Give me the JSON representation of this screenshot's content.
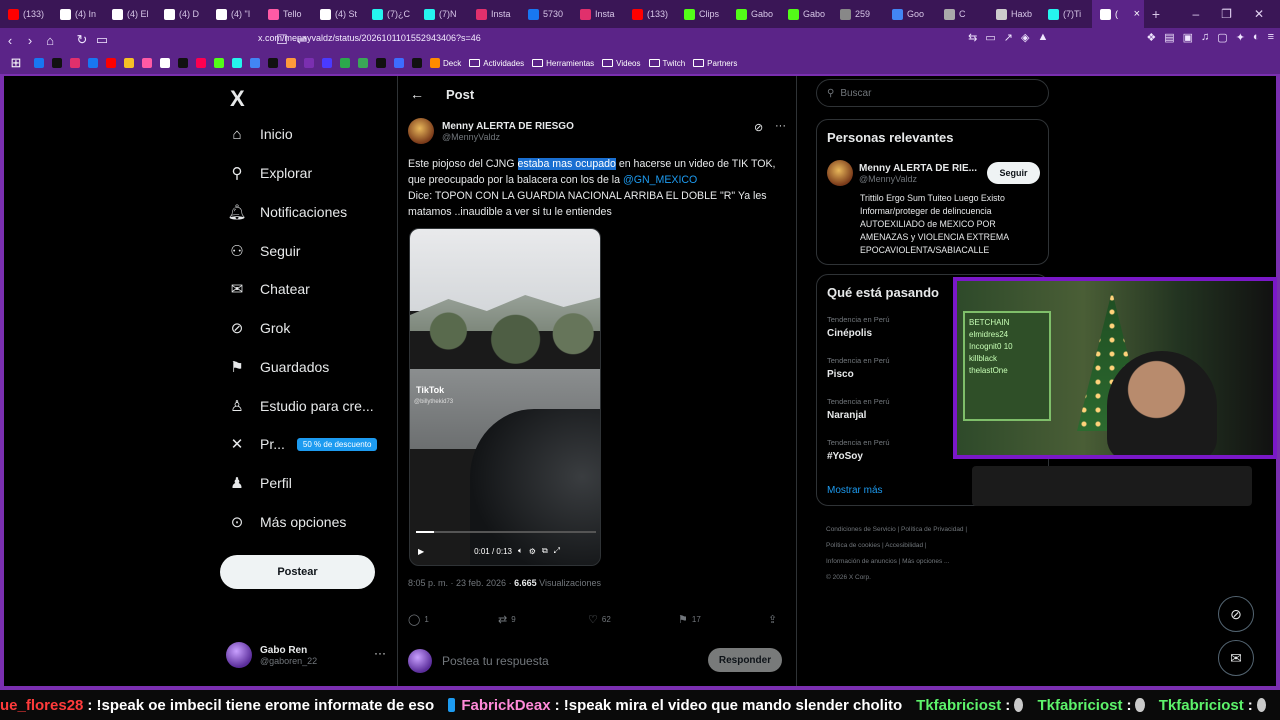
{
  "browser": {
    "tabs": [
      {
        "label": "(133)",
        "color": "#ff0000"
      },
      {
        "label": "(4) In",
        "color": "#ffffff"
      },
      {
        "label": "(4) El",
        "color": "#ffffff"
      },
      {
        "label": "(4) D",
        "color": "#ffffff"
      },
      {
        "label": "(4) \"I",
        "color": "#ffffff"
      },
      {
        "label": "Tello",
        "color": "#ff5aa5"
      },
      {
        "label": "(4) St",
        "color": "#ffffff"
      },
      {
        "label": "(7)¿C",
        "color": "#25f4ee"
      },
      {
        "label": "(7)N",
        "color": "#25f4ee"
      },
      {
        "label": "Insta",
        "color": "#e1306c"
      },
      {
        "label": "5730",
        "color": "#1877f2"
      },
      {
        "label": "Insta",
        "color": "#e1306c"
      },
      {
        "label": "(133)",
        "color": "#ff0000"
      },
      {
        "label": "Clips",
        "color": "#53fc18"
      },
      {
        "label": "Gabo",
        "color": "#53fc18"
      },
      {
        "label": "Gabo",
        "color": "#53fc18"
      },
      {
        "label": "259",
        "color": "#888888"
      },
      {
        "label": "Goo",
        "color": "#4285f4"
      },
      {
        "label": "C",
        "color": "#aaaaaa"
      },
      {
        "label": "Haxb",
        "color": "#cccccc"
      },
      {
        "label": "(7)Ti",
        "color": "#25f4ee"
      },
      {
        "label": "(",
        "color": "#ffffff"
      }
    ],
    "url": "x.com/mennyvaldz/status/2026101101552943406?s=46",
    "bookmarks": [
      "Deck",
      "Actividades",
      "Herramientas",
      "Videos",
      "Twitch",
      "Partners"
    ]
  },
  "nav": {
    "logo": "X",
    "items": [
      {
        "label": "Inicio"
      },
      {
        "label": "Explorar"
      },
      {
        "label": "Notificaciones"
      },
      {
        "label": "Seguir"
      },
      {
        "label": "Chatear"
      },
      {
        "label": "Grok"
      },
      {
        "label": "Guardados"
      },
      {
        "label": "Estudio para cre..."
      },
      {
        "label": "Pr..."
      },
      {
        "label": "Perfil"
      },
      {
        "label": "Más opciones"
      }
    ],
    "premium_badge": "50 % de descuento",
    "post_button": "Postear",
    "user": {
      "name": "Gabo Ren",
      "handle": "@gaboren_22"
    }
  },
  "post": {
    "header_title": "Post",
    "author_name": "Menny ALERTA DE RIESGO",
    "author_handle": "@MennyValdz",
    "text_before": "Este piojoso del CJNG ",
    "text_highlight": "estaba mas ocupado",
    "text_mid": " en hacerse un video de TIK TOK, que preocupado por la balacera con los de la ",
    "mention": "@GN_MEXICO",
    "text_after": "Dice: TOPON CON LA GUARDIA NACIONAL ARRIBA EL DOBLE \"R\" Ya les matamos ..inaudible a ver si tu le entiendes",
    "video": {
      "watermark": "TikTok",
      "watermark_user": "@billythekid73",
      "time": "0:01 / 0:13",
      "progress": 0.1
    },
    "time_date": "8:05 p. m. · 23 feb. 2026 · ",
    "views_count": "6.665",
    "views_label": "Visualizaciones",
    "stats": {
      "replies": "1",
      "reposts": "9",
      "likes": "62",
      "bookmarks": "17"
    },
    "reply_placeholder": "Postea tu respuesta",
    "reply_button": "Responder"
  },
  "sidebar": {
    "search_placeholder": "Buscar",
    "relevant_title": "Personas relevantes",
    "relevant_name": "Menny ALERTA DE RIE...",
    "relevant_handle": "@MennyValdz",
    "follow_button": "Seguir",
    "bio": "Trittilo Ergo Sum Tuiteo Luego Existo Informar/proteger de delincuencia AUTOEXILIADO de MEXICO POR AMENAZAS y VIOLENCIA EXTREMA EPOCAVIOLENTA/SABIACALLE",
    "trending_title": "Qué está pasando",
    "trends": [
      {
        "context": "Tendencia en Perú",
        "topic": "Cinépolis"
      },
      {
        "context": "Tendencia en Perú",
        "topic": "Pisco"
      },
      {
        "context": "Tendencia en Perú",
        "topic": "Naranjal"
      },
      {
        "context": "Tendencia en Perú",
        "topic": "#YoSoy"
      }
    ],
    "show_more": "Mostrar más",
    "footer": [
      "Condiciones de Servicio",
      "Política de Privacidad",
      "Política de cookies",
      "Accesibilidad",
      "Información de anuncios",
      "Más opciones ...",
      "© 2026 X Corp."
    ]
  },
  "webcam": {
    "board_lines": [
      "BETCHAIN",
      "elmidres24",
      "Incognit0 10",
      "killblack",
      "thelastOne"
    ]
  },
  "chat": {
    "messages": [
      {
        "user": "ue_flores28",
        "user_color": "#ff3b3b",
        "text": ": !speak oe imbecil tiene erome informate de eso"
      },
      {
        "user": "FabrickDeax",
        "user_color": "#ff8ad8",
        "text": ": !speak mira el video que mando slender cholito"
      },
      {
        "user": "Tkfabriciost",
        "user_color": "#5df36b",
        "text": ":"
      },
      {
        "user": "Tkfabriciost",
        "user_color": "#5df36b",
        "text": ":"
      },
      {
        "user": "Tkfabriciost",
        "user_color": "#5df36b",
        "text": ":"
      }
    ]
  }
}
